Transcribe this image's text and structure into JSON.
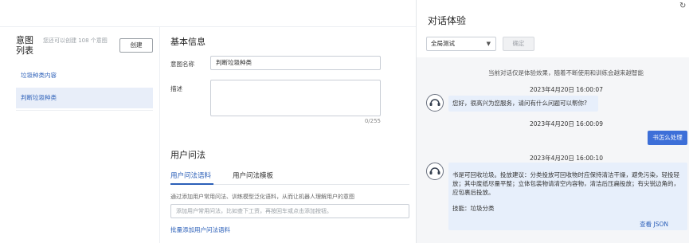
{
  "sidebar": {
    "title": "意图列表",
    "hint": "您还可以创建 108 个意图",
    "create_label": "创建",
    "items": [
      {
        "label": "垃圾种类内容"
      },
      {
        "label": "判断垃圾种类"
      }
    ]
  },
  "main": {
    "basic_title": "基本信息",
    "name_label": "意图名称",
    "name_value": "判断垃圾种类",
    "desc_label": "描述",
    "desc_count": "0/255",
    "phrase_title": "用户问法",
    "tabs": [
      {
        "label": "用户问法语料"
      },
      {
        "label": "用户问法模板"
      }
    ],
    "phrase_desc": "通过添加用户常用问法、训练模型泛化语料，从而让机器人理解用户的意图",
    "phrase_placeholder": "添加用户常用问法，比如查下工资，再按回车或点击添加按钮。",
    "batch_label": "批量添加用户问法语料"
  },
  "panel": {
    "title": "对话体验",
    "refresh_icon": "refresh-icon",
    "select_value": "全局测试",
    "confirm_label": "确定",
    "notice": "当前对话仅是体验效果，随着不断使用和训练会越来越智能",
    "messages": [
      {
        "time": "2023年4月20日 16:00:07",
        "text": "您好，很高兴为您服务，请问有什么问题可以帮你?"
      },
      {
        "time": "2023年4月20日 16:00:09",
        "text": "书怎么处理"
      },
      {
        "time": "2023年4月20日 16:00:10",
        "lines": [
          "书是可回收垃圾。投放建议：分类投放可回收物时应保持清洁干燥，避免污染，轻投轻",
          "放；其中废纸尽量平整；立体包装物请清空内容物，清洁后压扁投放；有尖锐边角的，",
          "应包裹后投放。"
        ],
        "skill": "技能：垃圾分类",
        "json_link": "查看 JSON"
      }
    ]
  }
}
